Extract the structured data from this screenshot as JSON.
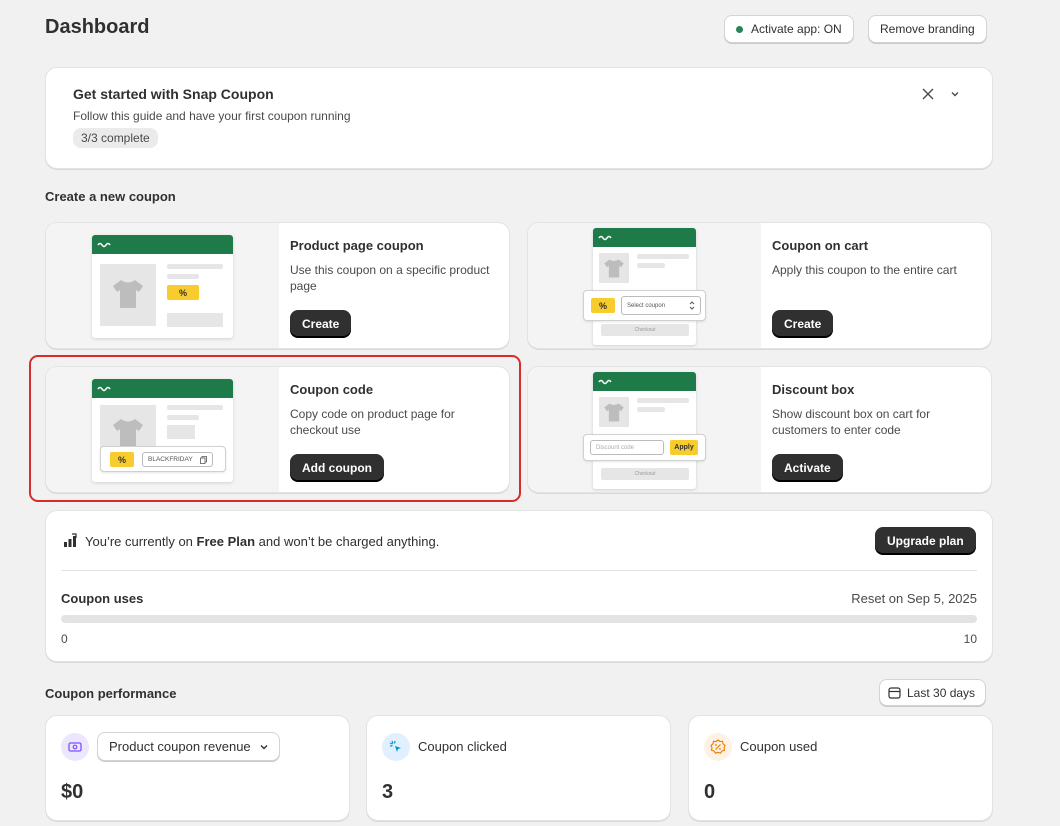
{
  "page": {
    "title": "Dashboard"
  },
  "header": {
    "activate_label": "Activate app: ON",
    "remove_branding_label": "Remove branding",
    "status_color": "#29845a"
  },
  "guide": {
    "title": "Get started with Snap Coupon",
    "subtitle": "Follow this guide and have your first coupon running",
    "progress": "3/3 complete"
  },
  "create_section": {
    "title": "Create a new coupon"
  },
  "coupons": [
    {
      "title": "Product page coupon",
      "description": "Use this coupon on a specific product page",
      "button": "Create"
    },
    {
      "title": "Coupon on cart",
      "description": "Apply this coupon to the entire cart",
      "button": "Create",
      "mock_select": "Select coupon",
      "mock_checkout": "Checkout"
    },
    {
      "title": "Coupon code",
      "description": "Copy code on product page for checkout use",
      "button": "Add coupon",
      "mock_code": "BLACKFRIDAY"
    },
    {
      "title": "Discount box",
      "description": "Show discount box on cart for customers to enter code",
      "button": "Activate",
      "mock_input": "Discount code",
      "mock_apply": "Apply",
      "mock_checkout": "Checkout"
    }
  ],
  "tag_symbol": "%",
  "plan": {
    "text_before": "You’re currently on ",
    "plan_name": "Free Plan",
    "text_after": " and won’t be charged anything.",
    "upgrade_label": "Upgrade plan",
    "uses_label": "Coupon uses",
    "reset_text": "Reset on Sep 5, 2025",
    "min": "0",
    "max": "10",
    "used_fraction": 0
  },
  "performance": {
    "title": "Coupon performance",
    "range_label": "Last 30 days",
    "metrics": [
      {
        "label": "Product coupon revenue",
        "value": "$0",
        "icon": "revenue-icon",
        "icon_bg": "#ece7fc",
        "icon_color": "#8051ff"
      },
      {
        "label": "Coupon clicked",
        "value": "3",
        "icon": "click-icon",
        "icon_bg": "#e0f0ff",
        "icon_color": "#0094d5"
      },
      {
        "label": "Coupon used",
        "value": "0",
        "icon": "discount-icon",
        "icon_bg": "#fff1e3",
        "icon_color": "#e67e00"
      }
    ]
  },
  "colors": {
    "brand_green": "#1f7a4a",
    "tag_yellow": "#f8cc2c",
    "highlight_red": "#d82c2c"
  }
}
